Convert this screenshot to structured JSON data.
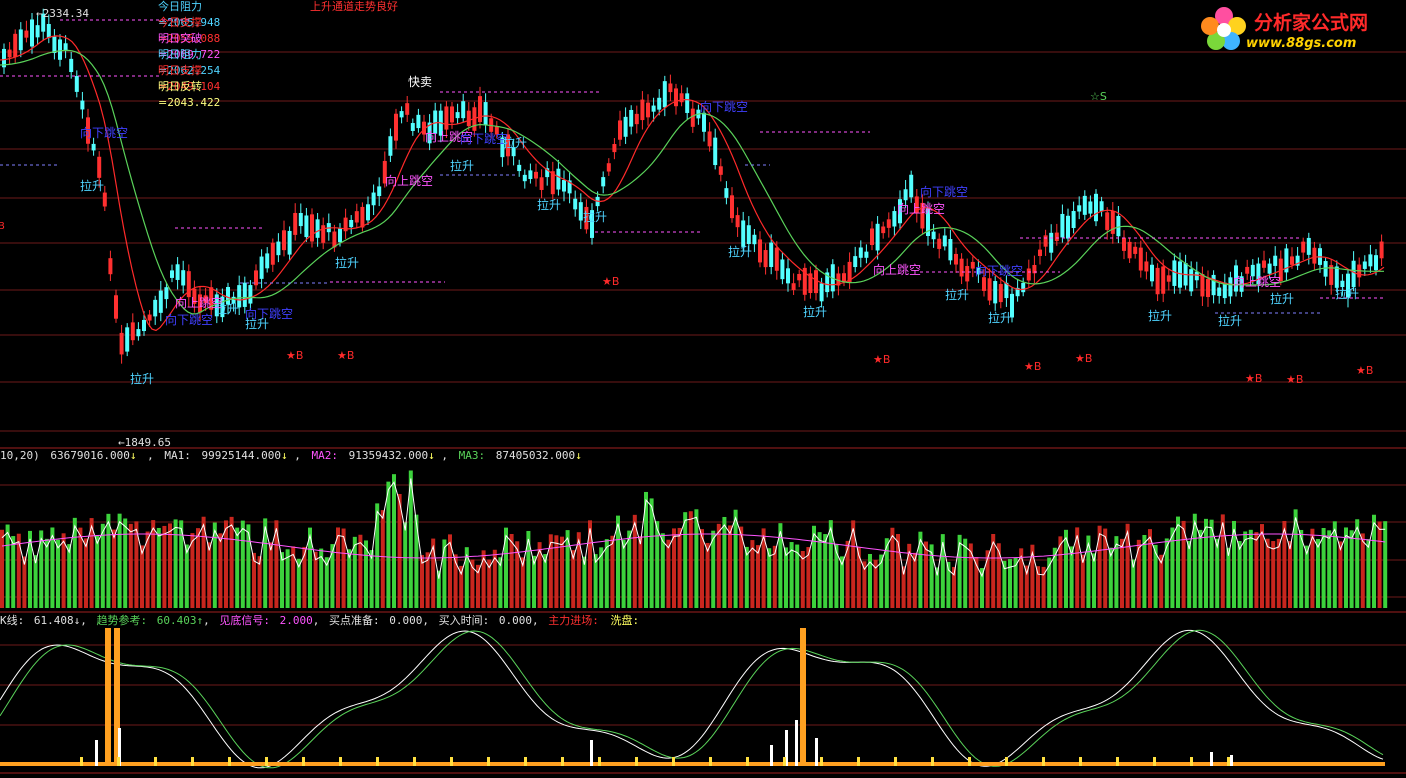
{
  "main_panel": {
    "top_price_label": "2334.34",
    "bottom_price_label": "1849.65",
    "levels": [
      {
        "label": "今日阻力=",
        "value": "2065.948",
        "label_color": "#4fd3ff",
        "value_color": "#4fd3ff"
      },
      {
        "label": "今日支撑=",
        "value": "2055.088",
        "label_color": "#ff3030",
        "value_color": "#ff3030"
      },
      {
        "label": "明日突破=",
        "value": "2069.722",
        "label_color": "#ff55ff",
        "value_color": "#ff55ff"
      },
      {
        "label": "明日阻力=",
        "value": "2062.254",
        "label_color": "#4fd3ff",
        "value_color": "#4fd3ff"
      },
      {
        "label": "明日支撑=",
        "value": "2049.104",
        "label_color": "#ff3030",
        "value_color": "#ff3030"
      },
      {
        "label": "明日反转=",
        "value": "2043.422",
        "label_color": "#ffff80",
        "value_color": "#ffff80"
      }
    ],
    "trend_note": "上升通道走势良好",
    "signal_texts": {
      "gap_down": "向下跳空",
      "gap_up": "向上跳空",
      "pull_up": "拉升",
      "sell": "快卖",
      "buy_star": "★B",
      "sell_star": "☆S"
    },
    "partial_left_label": "B"
  },
  "watermark": {
    "title": "分析家公式网",
    "url": "www.88gs.com"
  },
  "volume_panel": {
    "header_prefix": "10,20)",
    "header_value": "63679016.000",
    "ma1_label": "MA1:",
    "ma1_value": "99925144.000",
    "ma2_label": "MA2:",
    "ma2_value": "91359432.000",
    "ma3_label": "MA3:",
    "ma3_value": "87405032.000",
    "arrow": "↓"
  },
  "indicator_panel": {
    "line_label": "K线:",
    "line_value": "61.408",
    "line_arrow": "↓",
    "trend_label": "趋势参考:",
    "trend_value": "60.403",
    "trend_arrow": "↑",
    "bottom_label": "见底信号:",
    "bottom_value": "2.000",
    "buy_prep_label": "买点准备:",
    "buy_prep_value": "0.000",
    "buy_time_label": "买入时间:",
    "buy_time_value": "0.000",
    "main_force_label": "主力进场:",
    "wash_label": "洗盘:"
  },
  "colors": {
    "up_candle": "#ff3030",
    "down_candle": "#54ffff",
    "volume_up": "#c8261e",
    "volume_down": "#3cd23c",
    "ma_red": "#ff2a2a",
    "ma_green": "#5ad25a",
    "grid": "#6e1a1a",
    "signal_blue": "#4040ff",
    "signal_magenta": "#ff55ff",
    "orange": "#ffa020",
    "yellow": "#ffe040"
  }
}
